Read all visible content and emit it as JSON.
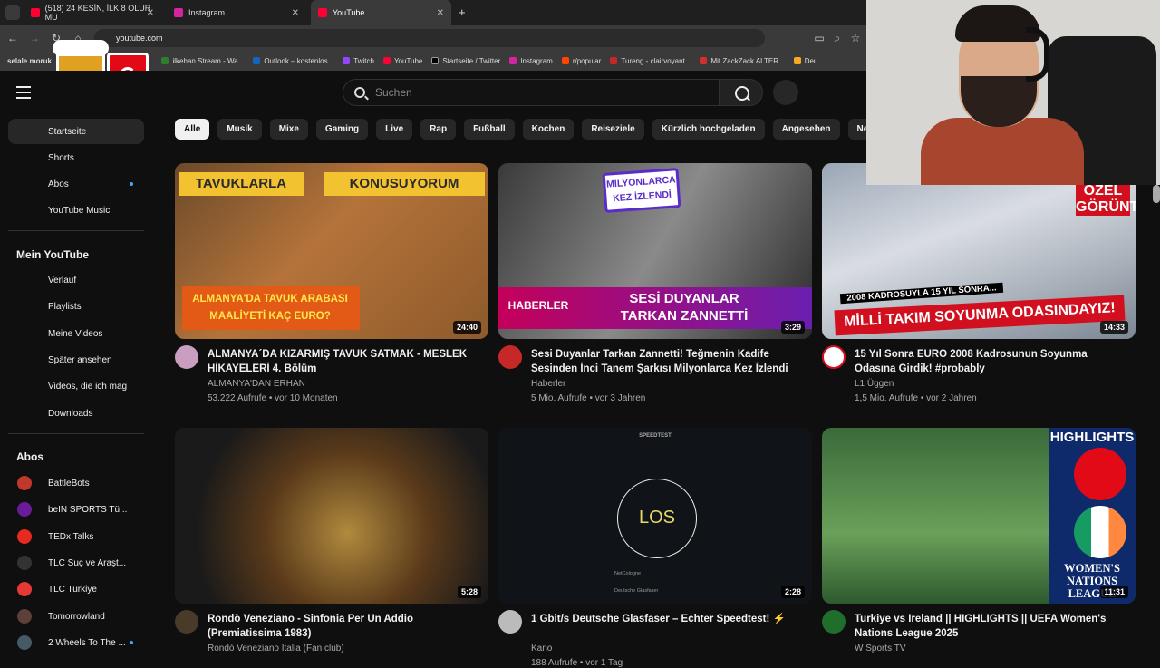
{
  "browser": {
    "tabs": [
      {
        "label": "(518) 24 KESİN, İLK 8 OLUR MU",
        "color": "#ff0033"
      },
      {
        "label": "Instagram",
        "color": "#d6249f"
      },
      {
        "label": "YouTube",
        "color": "#ff0033"
      }
    ],
    "url": "youtube.com",
    "bookmarks_leading": "selale moruk",
    "bookmarks": [
      "ilkehan Stream - Wa...",
      "Outlook – kostenlos...",
      "Twitch",
      "YouTube",
      "Startseite / Twitter",
      "Instagram",
      "r/popular",
      "Tureng - clairvoyant...",
      "Mit ZackZack ALTER...",
      "Deu"
    ]
  },
  "header": {
    "search_placeholder": "Suchen"
  },
  "sidebar": {
    "main": [
      "Startseite",
      "Shorts",
      "Abos",
      "YouTube Music"
    ],
    "you_title": "Mein YouTube",
    "you_items": [
      "Verlauf",
      "Playlists",
      "Meine Videos",
      "Später ansehen",
      "Videos, die ich mag",
      "Downloads"
    ],
    "subs_title": "Abos",
    "subs": [
      {
        "name": "BattleBots",
        "color": "#c0392b"
      },
      {
        "name": "beIN SPORTS Tü...",
        "color": "#6a1b9a"
      },
      {
        "name": "TEDx Talks",
        "color": "#e62b1e"
      },
      {
        "name": "TLC Suç ve Araşt...",
        "color": "#333333"
      },
      {
        "name": "TLC Turkiye",
        "color": "#e53935"
      },
      {
        "name": "Tomorrowland",
        "color": "#5d4037"
      },
      {
        "name": "2 Wheels To The ...",
        "color": "#455a64"
      }
    ]
  },
  "chips": [
    "Alle",
    "Musik",
    "Mixe",
    "Gaming",
    "Live",
    "Rap",
    "Fußball",
    "Kochen",
    "Reiseziele",
    "Kürzlich hochgeladen",
    "Angesehen",
    "Neu für dich"
  ],
  "videos": [
    {
      "title": "ALMANYA´DA KIZARMIŞ TAVUK SATMAK - MESLEK HİKAYELERİ 4. Bölüm",
      "channel": "ALMANYA'DAN ERHAN",
      "meta": "53.222 Aufrufe • vor 10 Monaten",
      "duration": "24:40",
      "thumb_top": "TAVUKLARLA",
      "thumb_top2": "KONUSUYORUM",
      "thumb_bottom": "ALMANYA'DA TAVUK ARABASI MAALİYETİ KAÇ EURO?"
    },
    {
      "title": "Sesi Duyanlar Tarkan Zannetti! Teğmenin Kadife Sesinden İnci Tanem Şarkısı Milyonlarca Kez İzlendi",
      "channel": "Haberler",
      "meta": "5 Mio. Aufrufe • vor 3 Jahren",
      "duration": "3:29",
      "thumb_top": "MİLYONLARCA KEZ İZLENDİ",
      "thumb_bottom": "SESİ DUYANLAR TARKAN ZANNETTİ",
      "thumb_left": "HABERLER"
    },
    {
      "title": "15 Yıl Sonra EURO 2008 Kadrosunun Soyunma Odasına Girdik! #probably",
      "channel": "L1 Üggen",
      "meta": "1,5 Mio. Aufrufe • vor 2 Jahren",
      "duration": "14:33",
      "thumb_top": "ÖZEL GÖRÜNTÜLER",
      "thumb_mid": "2008 KADROSUYLA 15 YIL SONRA...",
      "thumb_bottom": "MİLLİ TAKIM SOYUNMA ODASINDAYIZ!"
    },
    {
      "title": "Rondò Veneziano - Sinfonia Per Un Addio (Premiatissima 1983)",
      "channel": "Rondò Veneziano Italia (Fan club)",
      "meta": "",
      "duration": "5:28"
    },
    {
      "title": "1 Gbit/s Deutsche Glasfaser – Echter Speedtest! ⚡",
      "channel": "Kano",
      "meta": "188 Aufrufe • vor 1 Tag",
      "duration": "2:28",
      "thumb_top": "SPEEDTEST",
      "thumb_center": "LOS",
      "thumb_l1": "NetCologne",
      "thumb_l2": "Deutsche Glasfaser"
    },
    {
      "title": "Turkiye vs Ireland || HIGHLIGHTS || UEFA Women's Nations League 2025",
      "channel": "W Sports TV",
      "meta": "",
      "duration": "11:31",
      "thumb_top": "HIGHLIGHTS",
      "thumb_bottom": "WOMEN'S NATIONS LEAGUE"
    }
  ]
}
